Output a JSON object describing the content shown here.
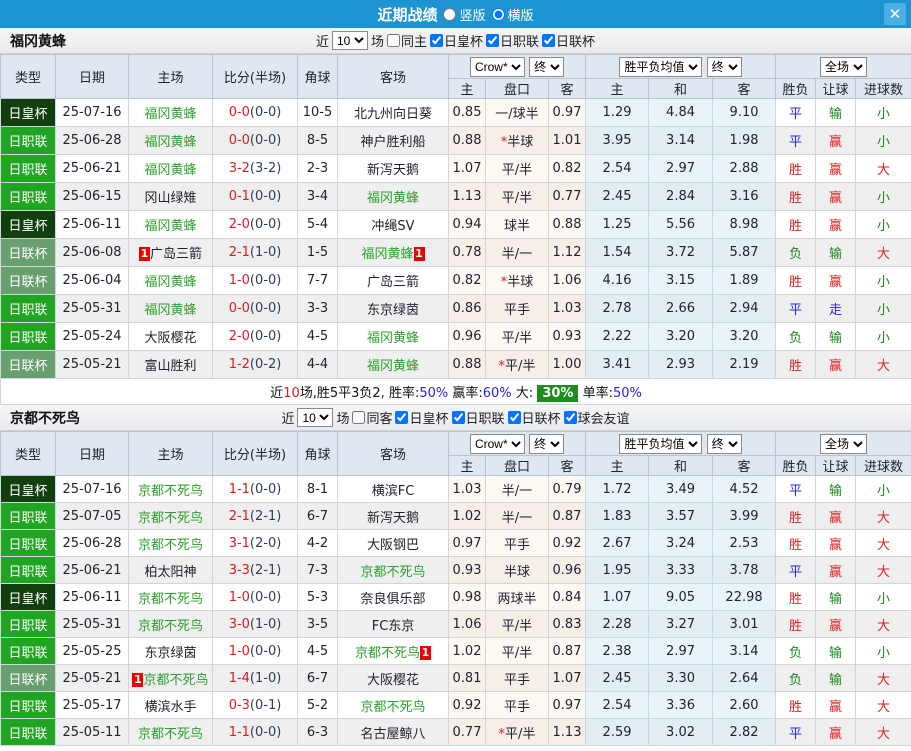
{
  "titlebar": {
    "title": "近期战绩",
    "vertical_label": "竖版",
    "horizontal_label": "横版",
    "close_glyph": "✕"
  },
  "table_header": {
    "type": "类型",
    "date": "日期",
    "home": "主场",
    "score": "比分(半场)",
    "corner": "角球",
    "away": "客场",
    "odds_provider": "Crow*",
    "final1": "终",
    "avg_label": "胜平负均值",
    "final2": "终",
    "scope": "全场",
    "sub": [
      "主",
      "盘口",
      "客",
      "主",
      "和",
      "客",
      "胜负",
      "让球",
      "进球数"
    ]
  },
  "colors": {
    "type": {
      "日皇杯": "t-cup",
      "日职联": "t-lea",
      "日联杯": "t-lcup"
    },
    "verdict": {
      "胜": "c-red",
      "平": "c-blue",
      "负": "c-green",
      "赢": "c-red",
      "走": "c-blue",
      "输": "c-green",
      "大": "c-red",
      "小": "c-green"
    }
  },
  "sections": [
    {
      "team": "福冈黄蜂",
      "controls": {
        "near": "近",
        "count": "10",
        "games": "场",
        "same_label": "同主",
        "same_checked": false,
        "leagues": [
          {
            "label": "日皇杯",
            "checked": true
          },
          {
            "label": "日职联",
            "checked": true
          },
          {
            "label": "日联杯",
            "checked": true
          }
        ]
      },
      "rows": [
        {
          "t": "日皇杯",
          "d": "25-07-16",
          "h": "福冈黄蜂",
          "hg": true,
          "hcard": false,
          "s": "0-0",
          "hf": "(0-0)",
          "c": "10-5",
          "a": "北九州向日葵",
          "ag": false,
          "acard": false,
          "o1": "0.85",
          "st": false,
          "hd": "一/球半",
          "o2": "0.97",
          "m1": "1.29",
          "m2": "4.84",
          "m3": "9.10",
          "r": "平",
          "l": "输",
          "g": "小"
        },
        {
          "t": "日职联",
          "d": "25-06-28",
          "h": "福冈黄蜂",
          "hg": true,
          "hcard": false,
          "s": "0-0",
          "hf": "(0-0)",
          "c": "8-5",
          "a": "神户胜利船",
          "ag": false,
          "acard": false,
          "o1": "0.88",
          "st": true,
          "hd": "半球",
          "o2": "1.01",
          "m1": "3.95",
          "m2": "3.14",
          "m3": "1.98",
          "r": "平",
          "l": "赢",
          "g": "小"
        },
        {
          "t": "日职联",
          "d": "25-06-21",
          "h": "福冈黄蜂",
          "hg": true,
          "hcard": false,
          "s": "3-2",
          "hf": "(3-2)",
          "c": "2-3",
          "a": "新泻天鹅",
          "ag": false,
          "acard": false,
          "o1": "1.07",
          "st": false,
          "hd": "平/半",
          "o2": "0.82",
          "m1": "2.54",
          "m2": "2.97",
          "m3": "2.88",
          "r": "胜",
          "l": "赢",
          "g": "大"
        },
        {
          "t": "日职联",
          "d": "25-06-15",
          "h": "冈山绿雉",
          "hg": false,
          "hcard": false,
          "s": "0-1",
          "hf": "(0-0)",
          "c": "3-4",
          "a": "福冈黄蜂",
          "ag": true,
          "acard": false,
          "o1": "1.13",
          "st": false,
          "hd": "平/半",
          "o2": "0.77",
          "m1": "2.45",
          "m2": "2.84",
          "m3": "3.16",
          "r": "胜",
          "l": "赢",
          "g": "小"
        },
        {
          "t": "日皇杯",
          "d": "25-06-11",
          "h": "福冈黄蜂",
          "hg": true,
          "hcard": false,
          "s": "2-0",
          "hf": "(0-0)",
          "c": "5-4",
          "a": "冲绳SV",
          "ag": false,
          "acard": false,
          "o1": "0.94",
          "st": false,
          "hd": "球半",
          "o2": "0.88",
          "m1": "1.25",
          "m2": "5.56",
          "m3": "8.98",
          "r": "胜",
          "l": "赢",
          "g": "小"
        },
        {
          "t": "日联杯",
          "d": "25-06-08",
          "h": "广岛三箭",
          "hg": false,
          "hcard": true,
          "s": "2-1",
          "hf": "(1-0)",
          "c": "1-5",
          "a": "福冈黄蜂",
          "ag": true,
          "acard": true,
          "o1": "0.78",
          "st": false,
          "hd": "半/一",
          "o2": "1.12",
          "m1": "1.54",
          "m2": "3.72",
          "m3": "5.87",
          "r": "负",
          "l": "输",
          "g": "大"
        },
        {
          "t": "日联杯",
          "d": "25-06-04",
          "h": "福冈黄蜂",
          "hg": true,
          "hcard": false,
          "s": "1-0",
          "hf": "(0-0)",
          "c": "7-7",
          "a": "广岛三箭",
          "ag": false,
          "acard": false,
          "o1": "0.82",
          "st": true,
          "hd": "半球",
          "o2": "1.06",
          "m1": "4.16",
          "m2": "3.15",
          "m3": "1.89",
          "r": "胜",
          "l": "赢",
          "g": "小"
        },
        {
          "t": "日职联",
          "d": "25-05-31",
          "h": "福冈黄蜂",
          "hg": true,
          "hcard": false,
          "s": "0-0",
          "hf": "(0-0)",
          "c": "3-3",
          "a": "东京绿茵",
          "ag": false,
          "acard": false,
          "o1": "0.86",
          "st": false,
          "hd": "平手",
          "o2": "1.03",
          "m1": "2.78",
          "m2": "2.66",
          "m3": "2.94",
          "r": "平",
          "l": "走",
          "g": "小"
        },
        {
          "t": "日职联",
          "d": "25-05-24",
          "h": "大阪樱花",
          "hg": false,
          "hcard": false,
          "s": "2-0",
          "hf": "(0-0)",
          "c": "4-5",
          "a": "福冈黄蜂",
          "ag": true,
          "acard": false,
          "o1": "0.96",
          "st": false,
          "hd": "平/半",
          "o2": "0.93",
          "m1": "2.22",
          "m2": "3.20",
          "m3": "3.20",
          "r": "负",
          "l": "输",
          "g": "小"
        },
        {
          "t": "日联杯",
          "d": "25-05-21",
          "h": "富山胜利",
          "hg": false,
          "hcard": false,
          "s": "1-2",
          "hf": "(0-2)",
          "c": "4-4",
          "a": "福冈黄蜂",
          "ag": true,
          "acard": false,
          "o1": "0.88",
          "st": true,
          "hd": "平/半",
          "o2": "1.00",
          "m1": "3.41",
          "m2": "2.93",
          "m3": "2.19",
          "r": "胜",
          "l": "赢",
          "g": "大"
        }
      ],
      "summary": {
        "near": "近",
        "count": "10",
        "rest": "场,胜5平3负2, ",
        "win_label": "胜率:",
        "win": "50%",
        "profit_label": "赢率:",
        "profit": "60%",
        "big_label": "大:",
        "big": "30%",
        "single_label": "单率:",
        "single": "50%"
      }
    },
    {
      "team": "京都不死鸟",
      "controls": {
        "near": "近",
        "count": "10",
        "games": "场",
        "same_label": "同客",
        "same_checked": false,
        "leagues": [
          {
            "label": "日皇杯",
            "checked": true
          },
          {
            "label": "日职联",
            "checked": true
          },
          {
            "label": "日联杯",
            "checked": true
          },
          {
            "label": "球会友谊",
            "checked": true
          }
        ]
      },
      "rows": [
        {
          "t": "日皇杯",
          "d": "25-07-16",
          "h": "京都不死鸟",
          "hg": true,
          "hcard": false,
          "s": "1-1",
          "hf": "(0-0)",
          "c": "8-1",
          "a": "横滨FC",
          "ag": false,
          "acard": false,
          "o1": "1.03",
          "st": false,
          "hd": "半/一",
          "o2": "0.79",
          "m1": "1.72",
          "m2": "3.49",
          "m3": "4.52",
          "r": "平",
          "l": "输",
          "g": "小"
        },
        {
          "t": "日职联",
          "d": "25-07-05",
          "h": "京都不死鸟",
          "hg": true,
          "hcard": false,
          "s": "2-1",
          "hf": "(2-1)",
          "c": "6-7",
          "a": "新泻天鹅",
          "ag": false,
          "acard": false,
          "o1": "1.02",
          "st": false,
          "hd": "半/一",
          "o2": "0.87",
          "m1": "1.83",
          "m2": "3.57",
          "m3": "3.99",
          "r": "胜",
          "l": "赢",
          "g": "大"
        },
        {
          "t": "日职联",
          "d": "25-06-28",
          "h": "京都不死鸟",
          "hg": true,
          "hcard": false,
          "s": "3-1",
          "hf": "(2-0)",
          "c": "4-2",
          "a": "大阪钢巴",
          "ag": false,
          "acard": false,
          "o1": "0.97",
          "st": false,
          "hd": "平手",
          "o2": "0.92",
          "m1": "2.67",
          "m2": "3.24",
          "m3": "2.53",
          "r": "胜",
          "l": "赢",
          "g": "大"
        },
        {
          "t": "日职联",
          "d": "25-06-21",
          "h": "柏太阳神",
          "hg": false,
          "hcard": false,
          "s": "3-3",
          "hf": "(2-1)",
          "c": "7-3",
          "a": "京都不死鸟",
          "ag": true,
          "acard": false,
          "o1": "0.93",
          "st": false,
          "hd": "半球",
          "o2": "0.96",
          "m1": "1.95",
          "m2": "3.33",
          "m3": "3.78",
          "r": "平",
          "l": "赢",
          "g": "大"
        },
        {
          "t": "日皇杯",
          "d": "25-06-11",
          "h": "京都不死鸟",
          "hg": true,
          "hcard": false,
          "s": "1-0",
          "hf": "(0-0)",
          "c": "5-3",
          "a": "奈良俱乐部",
          "ag": false,
          "acard": false,
          "o1": "0.98",
          "st": false,
          "hd": "两球半",
          "o2": "0.84",
          "m1": "1.07",
          "m2": "9.05",
          "m3": "22.98",
          "r": "胜",
          "l": "输",
          "g": "小"
        },
        {
          "t": "日职联",
          "d": "25-05-31",
          "h": "京都不死鸟",
          "hg": true,
          "hcard": false,
          "s": "3-0",
          "hf": "(1-0)",
          "c": "3-5",
          "a": "FC东京",
          "ag": false,
          "acard": false,
          "o1": "1.06",
          "st": false,
          "hd": "平/半",
          "o2": "0.83",
          "m1": "2.28",
          "m2": "3.27",
          "m3": "3.01",
          "r": "胜",
          "l": "赢",
          "g": "大"
        },
        {
          "t": "日职联",
          "d": "25-05-25",
          "h": "东京绿茵",
          "hg": false,
          "hcard": false,
          "s": "1-0",
          "hf": "(0-0)",
          "c": "4-5",
          "a": "京都不死鸟",
          "ag": true,
          "acard": true,
          "o1": "1.02",
          "st": false,
          "hd": "平/半",
          "o2": "0.87",
          "m1": "2.38",
          "m2": "2.97",
          "m3": "3.14",
          "r": "负",
          "l": "输",
          "g": "小"
        },
        {
          "t": "日联杯",
          "d": "25-05-21",
          "h": "京都不死鸟",
          "hg": true,
          "hcard": true,
          "s": "1-4",
          "hf": "(1-0)",
          "c": "6-7",
          "a": "大阪樱花",
          "ag": false,
          "acard": false,
          "o1": "0.81",
          "st": false,
          "hd": "平手",
          "o2": "1.07",
          "m1": "2.45",
          "m2": "3.30",
          "m3": "2.64",
          "r": "负",
          "l": "输",
          "g": "大"
        },
        {
          "t": "日职联",
          "d": "25-05-17",
          "h": "横滨水手",
          "hg": false,
          "hcard": false,
          "s": "0-3",
          "hf": "(0-1)",
          "c": "5-2",
          "a": "京都不死鸟",
          "ag": true,
          "acard": false,
          "o1": "0.92",
          "st": false,
          "hd": "平手",
          "o2": "0.97",
          "m1": "2.54",
          "m2": "3.36",
          "m3": "2.60",
          "r": "胜",
          "l": "赢",
          "g": "大"
        },
        {
          "t": "日职联",
          "d": "25-05-11",
          "h": "京都不死鸟",
          "hg": true,
          "hcard": false,
          "s": "1-1",
          "hf": "(0-0)",
          "c": "6-3",
          "a": "名古屋鲸八",
          "ag": false,
          "acard": false,
          "o1": "0.77",
          "st": true,
          "hd": "平/半",
          "o2": "1.13",
          "m1": "2.59",
          "m2": "3.02",
          "m3": "2.82",
          "r": "平",
          "l": "赢",
          "g": "大"
        }
      ]
    }
  ]
}
